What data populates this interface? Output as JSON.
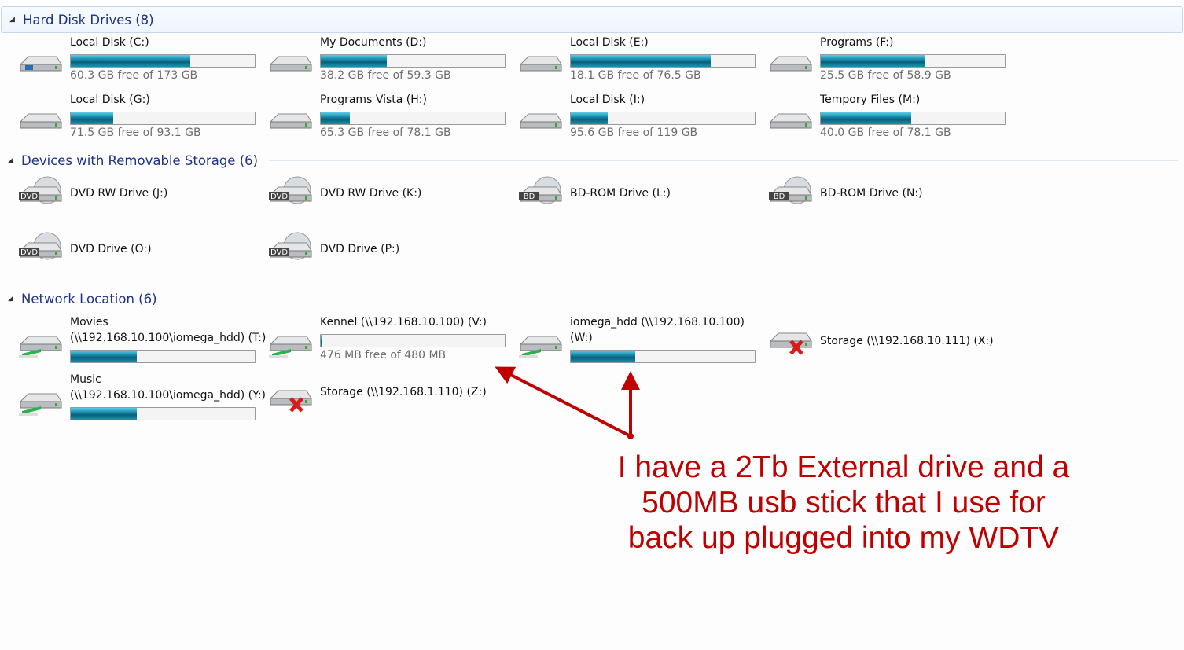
{
  "sections": [
    {
      "title": "Hard Disk Drives (8)",
      "items": [
        {
          "name": "Local Disk (C:)",
          "free": "60.3 GB free of 173 GB",
          "used": 0.65,
          "icon": "windows-drive-icon"
        },
        {
          "name": "My Documents (D:)",
          "free": "38.2 GB free of 59.3 GB",
          "used": 0.36,
          "icon": "hard-drive-icon"
        },
        {
          "name": "Local Disk (E:)",
          "free": "18.1 GB free of 76.5 GB",
          "used": 0.76,
          "icon": "hard-drive-icon"
        },
        {
          "name": "Programs (F:)",
          "free": "25.5 GB free of 58.9 GB",
          "used": 0.57,
          "icon": "hard-drive-icon"
        },
        {
          "name": "Local Disk (G:)",
          "free": "71.5 GB free of 93.1 GB",
          "used": 0.23,
          "icon": "hard-drive-icon"
        },
        {
          "name": "Programs Vista (H:)",
          "free": "65.3 GB free of 78.1 GB",
          "used": 0.16,
          "icon": "hard-drive-icon"
        },
        {
          "name": "Local Disk (I:)",
          "free": "95.6 GB free of 119 GB",
          "used": 0.2,
          "icon": "hard-drive-icon"
        },
        {
          "name": "Tempory Files (M:)",
          "free": "40.0 GB free of 78.1 GB",
          "used": 0.49,
          "icon": "hard-drive-icon"
        }
      ]
    },
    {
      "title": "Devices with Removable Storage (6)",
      "items": [
        {
          "name": "DVD RW Drive (J:)",
          "icon": "dvd-drive-icon",
          "badge": "DVD"
        },
        {
          "name": "DVD RW Drive (K:)",
          "icon": "dvd-drive-icon",
          "badge": "DVD"
        },
        {
          "name": "BD-ROM Drive (L:)",
          "icon": "bd-drive-icon",
          "badge": "BD"
        },
        {
          "name": "BD-ROM Drive (N:)",
          "icon": "bd-drive-icon",
          "badge": "BD"
        },
        {
          "name": "DVD Drive (O:)",
          "icon": "dvd-drive-icon",
          "badge": "DVD"
        },
        {
          "name": "DVD Drive (P:)",
          "icon": "dvd-drive-icon",
          "badge": "DVD"
        }
      ]
    },
    {
      "title": "Network Location (6)",
      "items": [
        {
          "name": "Movies",
          "name2": "(\\\\192.168.10.100\\iomega_hdd) (T:)",
          "used": 0.36,
          "icon": "network-drive-icon"
        },
        {
          "name": "Kennel (\\\\192.168.10.100) (V:)",
          "free": "476 MB free of 480 MB",
          "used": 0.01,
          "icon": "network-drive-icon"
        },
        {
          "name": "iomega_hdd (\\\\192.168.10.100)",
          "name2": "(W:)",
          "used": 0.35,
          "icon": "network-drive-icon"
        },
        {
          "name": "Storage (\\\\192.168.10.111) (X:)",
          "icon": "disconnected-network-drive-icon",
          "disconnected": true
        },
        {
          "name": "Music",
          "name2": "(\\\\192.168.10.100\\iomega_hdd) (Y:)",
          "used": 0.36,
          "icon": "network-drive-icon"
        },
        {
          "name": "Storage (\\\\192.168.1.110) (Z:)",
          "icon": "disconnected-network-drive-icon",
          "disconnected": true
        }
      ]
    }
  ],
  "annotation": {
    "lines": [
      "I have a 2Tb External drive and a",
      "500MB usb stick that I use for",
      "back up plugged into my WDTV"
    ],
    "color": "#c00000"
  },
  "colors": {
    "header": "#1e3287",
    "bar": "#1a8fae"
  }
}
